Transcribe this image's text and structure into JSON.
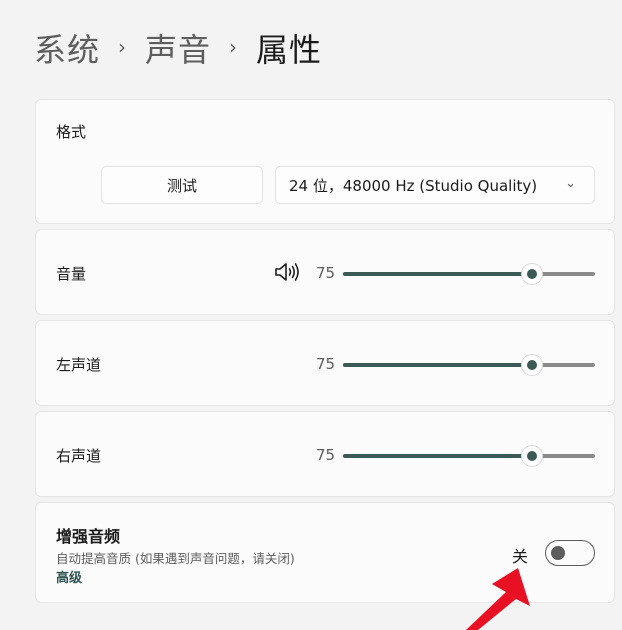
{
  "breadcrumb": {
    "items": [
      "系统",
      "声音"
    ],
    "current": "属性",
    "separator": "›"
  },
  "format": {
    "label": "格式",
    "test_button": "测试",
    "selected": "24 位，48000 Hz (Studio Quality)",
    "chevron": "⌄"
  },
  "volume": {
    "label": "音量",
    "value": "75",
    "level": 75,
    "icon": "speaker-icon"
  },
  "left_channel": {
    "label": "左声道",
    "value": "75",
    "level": 75
  },
  "right_channel": {
    "label": "右声道",
    "value": "75",
    "level": 75
  },
  "enhance": {
    "title": "增强音频",
    "description": "自动提高音质 (如果遇到声音问题，请关闭)",
    "link": "高级",
    "toggle_state_label": "关",
    "enabled": false
  },
  "colors": {
    "accent": "#3b5a56",
    "arrow": "#e81123"
  }
}
